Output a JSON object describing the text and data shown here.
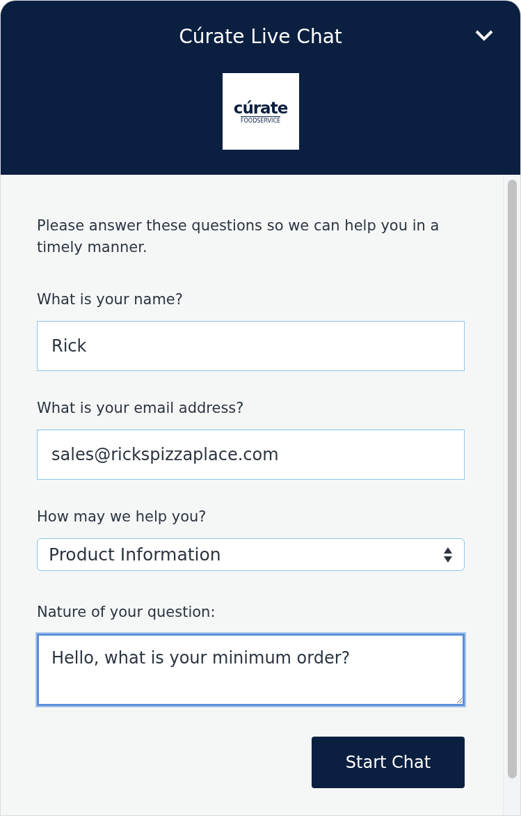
{
  "header": {
    "title": "Cúrate Live Chat",
    "logo": {
      "wordmark": "cúrate",
      "tagline": "FOODSERVICE"
    }
  },
  "intro": "Please answer these questions so we can help you in a timely manner.",
  "fields": [
    {
      "kind": "text",
      "label": "What is your name?",
      "value": "Rick",
      "focused": false
    },
    {
      "kind": "text",
      "label": "What is your email address?",
      "value": "sales@rickspizzaplace.com",
      "focused": false
    },
    {
      "kind": "select",
      "label": "How may we help you?",
      "value": "Product Information",
      "focused": false
    },
    {
      "kind": "textarea",
      "label": "Nature of your question:",
      "value": "Hello, what is your minimum order?",
      "focused": true
    }
  ],
  "submit": {
    "label": "Start Chat"
  }
}
